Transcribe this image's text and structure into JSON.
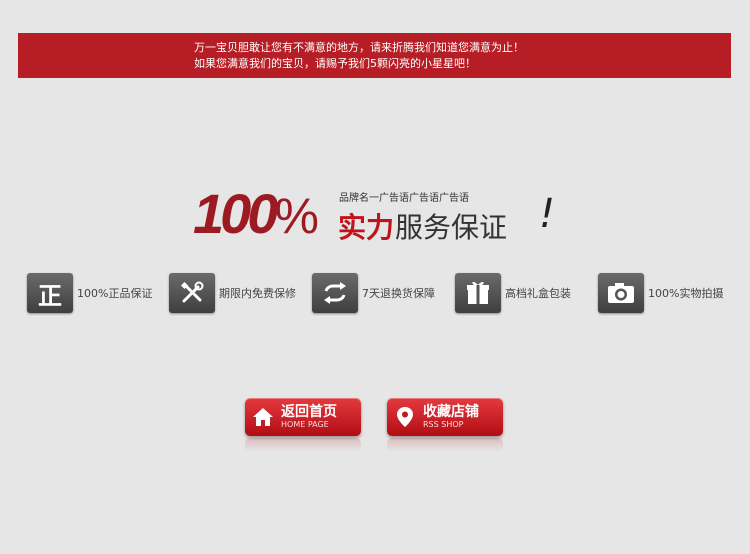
{
  "notice": {
    "line1": "万一宝贝胆敢让您有不满意的地方，请来折腾我们知道您满意为止！",
    "line2": "如果您满意我们的宝贝，请赐予我们5颗闪亮的小星星吧！"
  },
  "headline": {
    "percent": "100",
    "percent_sign": "%",
    "slogan": "品牌名一广告语广告语广告语",
    "strong": "实力",
    "rest": "服务保证",
    "bang": "!"
  },
  "features": [
    {
      "icon": "zheng-icon",
      "glyph": "正",
      "label": "100%正品保证"
    },
    {
      "icon": "tools-icon",
      "glyph": "",
      "label": "期限内免费保修"
    },
    {
      "icon": "refresh-icon",
      "glyph": "",
      "label": "7天退换货保障"
    },
    {
      "icon": "gift-icon",
      "glyph": "",
      "label": "高档礼盒包装"
    },
    {
      "icon": "camera-icon",
      "glyph": "",
      "label": "100%实物拍摄"
    }
  ],
  "buttons": {
    "home": {
      "cn": "返回首页",
      "en": "HOME PAGE",
      "icon": "home-icon"
    },
    "fav": {
      "cn": "收藏店铺",
      "en": "RSS SHOP",
      "icon": "location-pin-icon"
    }
  },
  "colors": {
    "red": "#b61d24",
    "bg": "#e6e6e6",
    "icon_bg": "#4a4a4a"
  }
}
